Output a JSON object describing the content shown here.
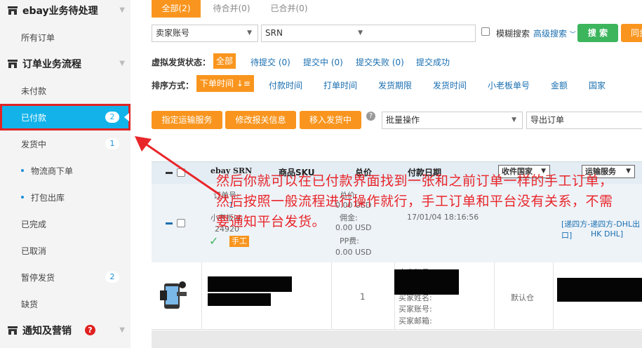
{
  "sidebar": {
    "sections": [
      {
        "label": "ebay业务待处理"
      },
      {
        "label": "订单业务流程"
      },
      {
        "label": "通知及营销"
      }
    ],
    "items": [
      {
        "label": "所有订单",
        "count": ""
      },
      {
        "label": "未付款",
        "count": ""
      },
      {
        "label": "已付款",
        "count": "2"
      },
      {
        "label": "发货中",
        "count": "1"
      },
      {
        "label": "物流商下单",
        "count": ""
      },
      {
        "label": "打包出库",
        "count": ""
      },
      {
        "label": "已完成",
        "count": ""
      },
      {
        "label": "已取消",
        "count": ""
      },
      {
        "label": "暂停发货",
        "count": "2"
      },
      {
        "label": "缺货",
        "count": ""
      }
    ],
    "notice_badge": "?"
  },
  "tabs": [
    "全部(2)",
    "待合并(0)",
    "已合并(0)"
  ],
  "search": {
    "account": "卖家账号",
    "field": "SRN",
    "fuzzy": "模糊搜索",
    "advanced": "高级搜索",
    "search_btn": "搜 索",
    "sync_btn": "同步"
  },
  "filter": {
    "label": "虚拟发货状态：",
    "options": [
      "全部",
      "待提交 (0)",
      "提交中 (0)",
      "提交失败 (0)",
      "提交成功"
    ]
  },
  "sort": {
    "label": "排序方式：",
    "active": "下单时间",
    "options": [
      "付款时间",
      "打单时间",
      "发货期限",
      "发货时间",
      "小老板单号",
      "金额",
      "国家"
    ]
  },
  "actions": {
    "assign_shipping": "指定运输服务",
    "edit_customs": "修改报关信息",
    "move_shipping": "移入发货中",
    "bulk": "批量操作",
    "export": "导出订单"
  },
  "table": {
    "headers": {
      "srn": "ebay SRN",
      "sku": "商品SKU",
      "total": "总价",
      "paydate": "付款日期",
      "country_sel": "收件国家",
      "service_sel": "运输服务"
    },
    "group": {
      "order_no_label": "订单号:",
      "order_no": "1",
      "xlb_label": "小老板id:",
      "xlb_id": "24920",
      "manual_tag": "手工",
      "total_label": "总价:",
      "total_value": "0.00 USD",
      "commission_label": "佣金:",
      "commission_value": "0.00 USD",
      "pp_label": "PP费:",
      "pp_value": "0.00 USD",
      "pay_date": "17/01/04 18:16:56",
      "shipping": "[递四方-递四方-DHL出口]",
      "shipping2": "HK DHL]"
    },
    "row": {
      "qty": "1",
      "seller_label": "卖家账号:",
      "buyer_name_label": "买家姓名:",
      "buyer_account_label": "买家账号:",
      "buyer_email_label": "买家邮箱:",
      "country": "默认仓"
    }
  },
  "annotation": "然后你就可以在已付款界面找到一张和之前订单一样的手工订单，然后按照一般流程进行操作就行，手工订单和平台没有关系，不需要通知平台发货。"
}
